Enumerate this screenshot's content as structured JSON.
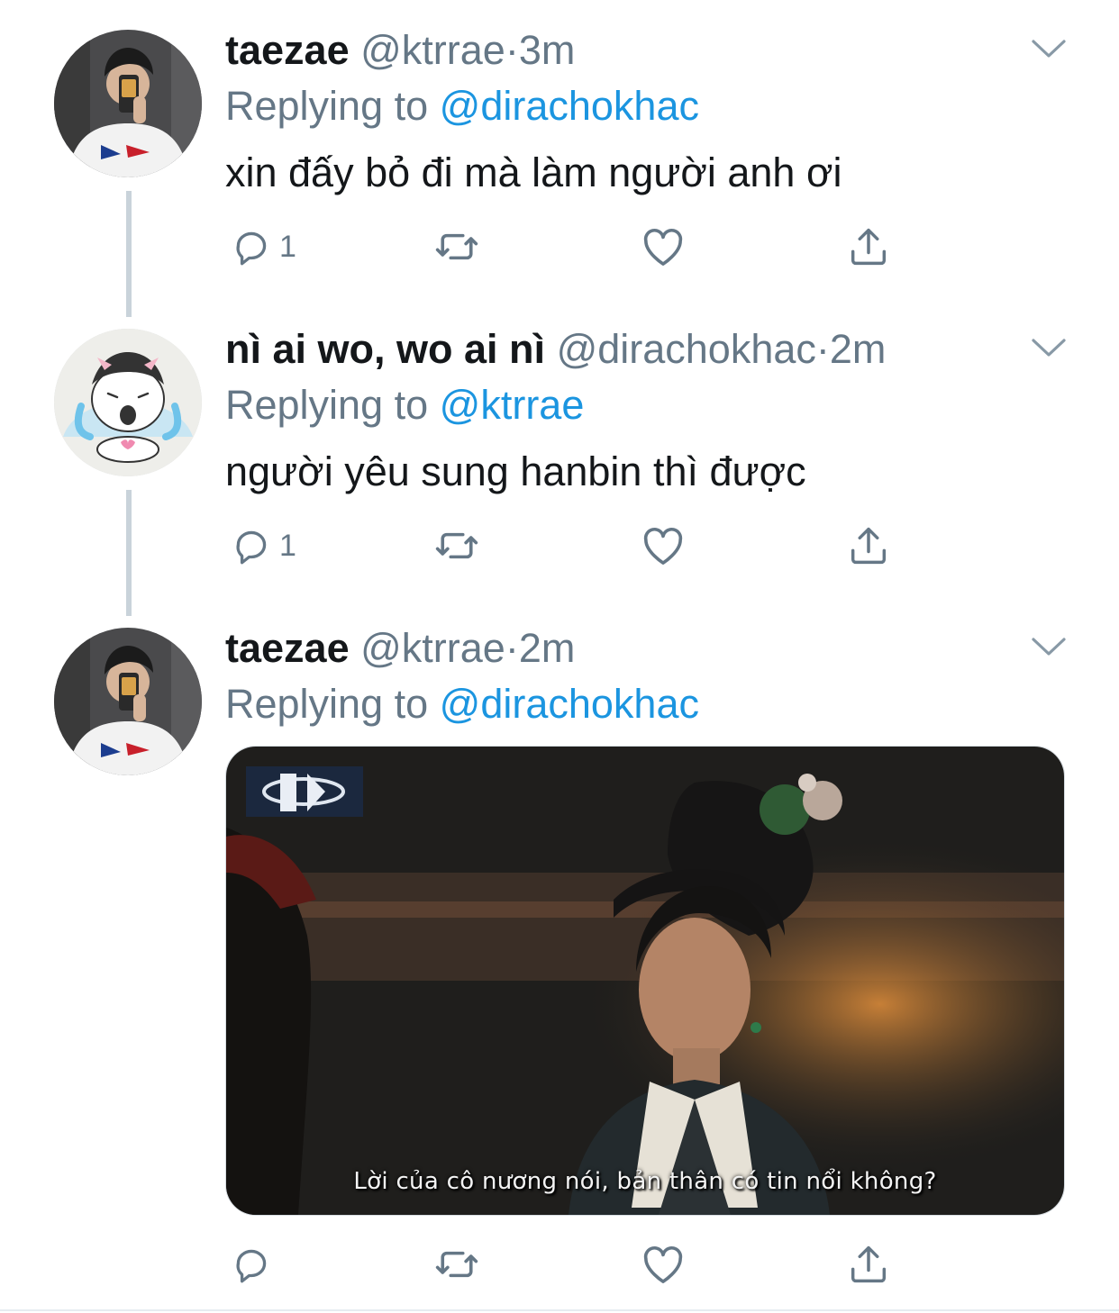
{
  "tweets": [
    {
      "name": "taezae",
      "handle": "@ktrrae",
      "separator": "·",
      "time": "3m",
      "replying_prefix": "Replying to",
      "replying_to": "@dirachokhac",
      "text": "xin đấy bỏ đi mà làm người anh ơi",
      "reply_count": "1",
      "avatar_icon": "selfie-avatar"
    },
    {
      "name": "nì ai wo, wo ai nì",
      "handle": "@dirachokhac",
      "separator": "·",
      "time": "2m",
      "replying_prefix": "Replying to",
      "replying_to": "@ktrrae",
      "text": "người yêu sung hanbin thì được",
      "reply_count": "1",
      "avatar_icon": "crying-cartoon-avatar"
    },
    {
      "name": "taezae",
      "handle": "@ktrrae",
      "separator": "·",
      "time": "2m",
      "replying_prefix": "Replying to",
      "replying_to": "@dirachokhac",
      "media_subtitle": "Lời của cô nương nói, bản thân có tin nổi không?",
      "reply_count": "",
      "avatar_icon": "selfie-avatar"
    }
  ],
  "icons": [
    "reply-icon",
    "retweet-icon",
    "like-icon",
    "share-icon",
    "chevron-down-icon"
  ],
  "colors": {
    "text": "#14171a",
    "secondary": "#657786",
    "link": "#1b95e0",
    "thread_line": "#c9d3da"
  }
}
